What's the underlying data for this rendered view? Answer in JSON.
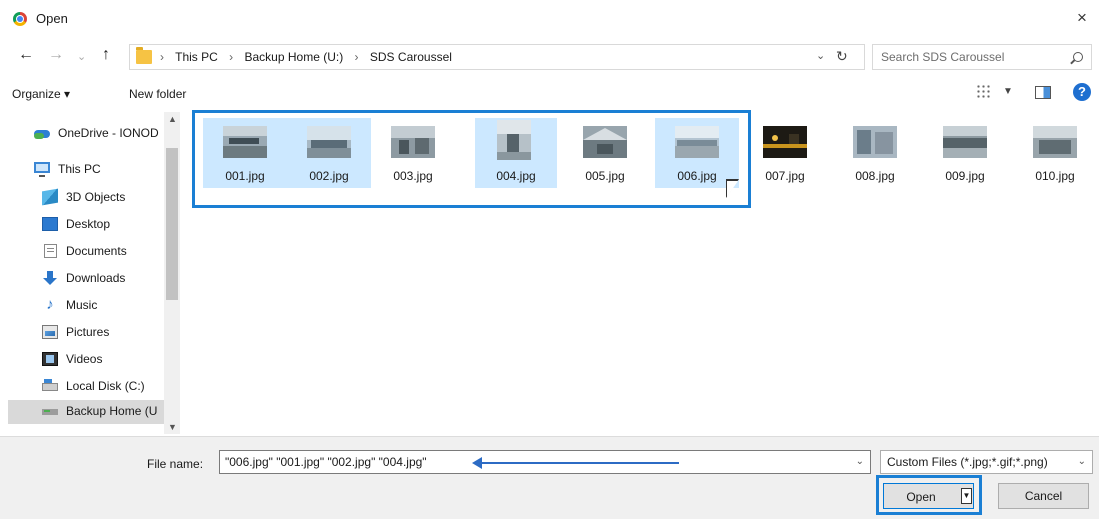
{
  "window": {
    "title": "Open",
    "close_glyph": "×"
  },
  "nav": {
    "back_glyph": "←",
    "forward_glyph": "→",
    "recent_glyph": "⌄",
    "up_glyph": "↑",
    "breadcrumbs": [
      "This PC",
      "Backup Home (U:)",
      "SDS Caroussel"
    ],
    "crumb_sep": "›",
    "search_placeholder": "Search SDS Caroussel"
  },
  "toolbar": {
    "organize_label": "Organize ▾",
    "new_folder_label": "New folder",
    "help_glyph": "?"
  },
  "sidebar": {
    "items": [
      {
        "label": "OneDrive - IONOD",
        "icon": "onedrive-icon"
      },
      {
        "label": "This PC",
        "icon": "computer-icon"
      },
      {
        "label": "3D Objects",
        "icon": "3d-objects-icon"
      },
      {
        "label": "Desktop",
        "icon": "desktop-icon"
      },
      {
        "label": "Documents",
        "icon": "documents-icon"
      },
      {
        "label": "Downloads",
        "icon": "downloads-icon"
      },
      {
        "label": "Music",
        "icon": "music-icon"
      },
      {
        "label": "Pictures",
        "icon": "pictures-icon"
      },
      {
        "label": "Videos",
        "icon": "videos-icon"
      },
      {
        "label": "Local Disk (C:)",
        "icon": "disk-icon"
      },
      {
        "label": "Backup Home (U",
        "icon": "network-drive-icon",
        "selected": true
      }
    ]
  },
  "files": [
    {
      "name": "001.jpg",
      "selected": true
    },
    {
      "name": "002.jpg",
      "selected": true
    },
    {
      "name": "003.jpg",
      "selected": false
    },
    {
      "name": "004.jpg",
      "selected": true
    },
    {
      "name": "005.jpg",
      "selected": false
    },
    {
      "name": "006.jpg",
      "selected": true
    },
    {
      "name": "007.jpg",
      "selected": false
    },
    {
      "name": "008.jpg",
      "selected": false
    },
    {
      "name": "009.jpg",
      "selected": false
    },
    {
      "name": "010.jpg",
      "selected": false
    }
  ],
  "footer": {
    "file_name_label": "File name:",
    "file_name_value": "\"006.jpg\" \"001.jpg\" \"002.jpg\" \"004.jpg\"",
    "file_type_value": "Custom Files (*.jpg;*.gif;*.png)",
    "open_label": "Open",
    "cancel_label": "Cancel"
  },
  "colors": {
    "selection": "#cce8ff",
    "highlight_frame": "#1a7fd4",
    "arrow": "#2c6bc4"
  }
}
